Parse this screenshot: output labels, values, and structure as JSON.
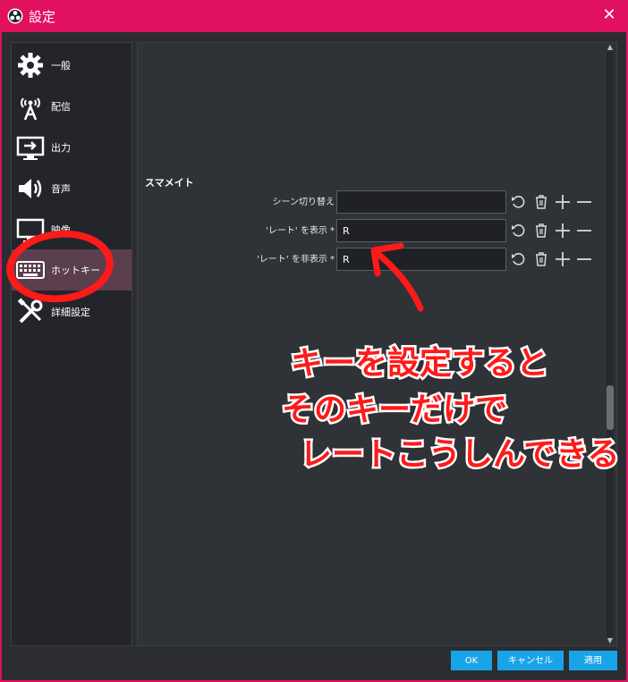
{
  "window": {
    "title": "設定"
  },
  "sidebar": {
    "items": [
      {
        "label": "一般",
        "icon": "gear-icon"
      },
      {
        "label": "配信",
        "icon": "broadcast-icon"
      },
      {
        "label": "出力",
        "icon": "output-icon"
      },
      {
        "label": "音声",
        "icon": "speaker-icon"
      },
      {
        "label": "映像",
        "icon": "monitor-icon"
      },
      {
        "label": "ホットキー",
        "icon": "keyboard-icon",
        "active": true
      },
      {
        "label": "詳細設定",
        "icon": "tools-icon"
      }
    ]
  },
  "hotkeys": {
    "section_title": "スマメイト",
    "rows": [
      {
        "label": "シーン切り替え",
        "value": ""
      },
      {
        "label": "'レート' を表示 *",
        "value": "R"
      },
      {
        "label": "'レート' を非表示 *",
        "value": "R"
      }
    ]
  },
  "footer": {
    "ok": "OK",
    "cancel": "キャンセル",
    "apply": "適用"
  },
  "annotation": {
    "line1": "キーを設定すると",
    "line2": "そのキーだけで",
    "line3": "レートこうしんできる",
    "color": "#ff1a1a"
  }
}
